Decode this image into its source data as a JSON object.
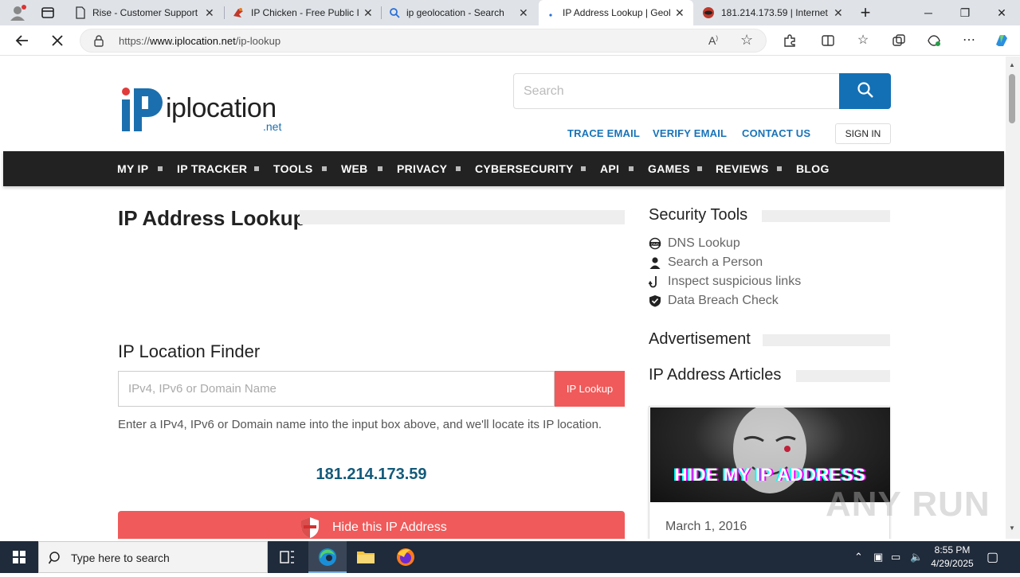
{
  "browser": {
    "tabs": [
      {
        "title": "Rise - Customer Support",
        "icon": "page-icon"
      },
      {
        "title": "IP Chicken - Free Public I",
        "icon": "chicken-icon"
      },
      {
        "title": "ip geolocation - Search",
        "icon": "search-icon"
      },
      {
        "title": "IP Address Lookup | Geol",
        "icon": "loading-dot-icon",
        "active": true
      },
      {
        "title": "181.214.173.59 | Internet",
        "icon": "ipinfo-icon"
      }
    ],
    "url_prefix": "https://",
    "url_domain": "www.iplocation.net",
    "url_path": "/ip-lookup"
  },
  "site": {
    "logo_text": "iplocation",
    "logo_suffix": ".net",
    "search_placeholder": "Search",
    "top_links": [
      "TRACE EMAIL",
      "VERIFY EMAIL",
      "CONTACT US"
    ],
    "sign_in": "SIGN IN",
    "nav": [
      "MY IP",
      "IP TRACKER",
      "TOOLS",
      "WEB",
      "PRIVACY",
      "CYBERSECURITY",
      "API",
      "GAMES",
      "REVIEWS",
      "BLOG"
    ]
  },
  "main": {
    "title": "IP Address Lookup",
    "finder_title": "IP Location Finder",
    "input_placeholder": "IPv4, IPv6 or Domain Name",
    "lookup_button": "IP Lookup",
    "help_text": "Enter a IPv4, IPv6 or Domain name into the input box above, and we'll locate its IP location.",
    "current_ip": "181.214.173.59",
    "hide_ip_button": "Hide this IP Address"
  },
  "sidebar": {
    "security_title": "Security Tools",
    "tools": [
      {
        "label": "DNS Lookup",
        "icon": "dns-icon"
      },
      {
        "label": "Search a Person",
        "icon": "person-icon"
      },
      {
        "label": "Inspect suspicious links",
        "icon": "hook-icon"
      },
      {
        "label": "Data Breach Check",
        "icon": "shield-check-icon"
      }
    ],
    "ad_title": "Advertisement",
    "articles_title": "IP Address Articles",
    "article": {
      "image_text": "HIDE MY IP ADDRESS",
      "date": "March 1, 2016"
    }
  },
  "watermark": "ANY RUN",
  "taskbar": {
    "search_placeholder": "Type here to search",
    "time": "8:55 PM",
    "date": "4/29/2025"
  },
  "colors": {
    "brand_blue": "#1470b5",
    "link_blue": "#1873b8",
    "nav_bg": "#222222",
    "accent_red": "#f05a5a",
    "ip_color": "#145a7a"
  }
}
